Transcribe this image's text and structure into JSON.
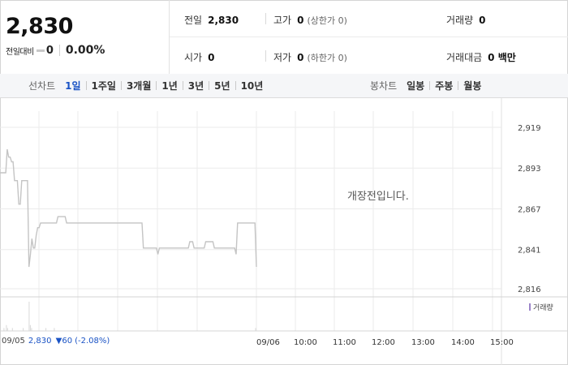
{
  "quote": {
    "price": "2,830",
    "change_label": "전일대비",
    "change_value": "0",
    "change_rate": "0.00%"
  },
  "stats": {
    "prev_close_label": "전일",
    "prev_close": "2,830",
    "high_label": "고가",
    "high": "0",
    "upper_limit": "(상한가 0)",
    "volume_label": "거래량",
    "volume": "0",
    "open_label": "시가",
    "open": "0",
    "low_label": "저가",
    "low": "0",
    "lower_limit": "(하한가 0)",
    "amount_label": "거래대금",
    "amount": "0 백만"
  },
  "tabs": {
    "line_title": "선차트",
    "line_items": [
      "1일",
      "1주일",
      "3개월",
      "1년",
      "3년",
      "5년",
      "10년"
    ],
    "active_index": 0,
    "candle_title": "봉차트",
    "candle_items": [
      "일봉",
      "주봉",
      "월봉"
    ]
  },
  "chart_data": {
    "type": "line",
    "y_ticks": [
      "2,919",
      "2,893",
      "2,867",
      "2,841",
      "2,816"
    ],
    "ylim": [
      2816,
      2919
    ],
    "x_labels": [
      "09/05",
      "09/06",
      "10:00",
      "11:00",
      "12:00",
      "13:00",
      "14:00",
      "15:00"
    ],
    "notice": "개장전입니다.",
    "volume_legend": "거래량",
    "prev_day_price": [
      2890,
      2890,
      2890,
      2890,
      2890,
      2905,
      2900,
      2900,
      2897,
      2897,
      2885,
      2885,
      2885,
      2870,
      2870,
      2885,
      2885,
      2885,
      2885,
      2885,
      2830,
      2838,
      2848,
      2842,
      2842,
      2850,
      2855,
      2855,
      2858,
      2858,
      2858,
      2858,
      2858,
      2858,
      2858,
      2858,
      2858,
      2858,
      2858,
      2858,
      2862,
      2862,
      2862,
      2862,
      2862,
      2862,
      2858,
      2858,
      2858,
      2858,
      2858,
      2858,
      2858,
      2858,
      2858,
      2858,
      2858,
      2858,
      2858,
      2858,
      2858,
      2858,
      2858,
      2858,
      2858,
      2858,
      2858,
      2858,
      2858,
      2858,
      2858,
      2858,
      2858,
      2858,
      2858,
      2858,
      2858,
      2858,
      2858,
      2858,
      2858,
      2858,
      2858,
      2858,
      2858,
      2858,
      2858,
      2858,
      2858,
      2858,
      2858,
      2858,
      2858,
      2858,
      2858,
      2858,
      2858,
      2858,
      2858,
      2842,
      2842,
      2842,
      2842,
      2842,
      2842,
      2842,
      2842,
      2842,
      2842,
      2838,
      2842,
      2842,
      2842,
      2842,
      2842,
      2842,
      2842,
      2842,
      2842,
      2842,
      2842,
      2842,
      2842,
      2842,
      2842,
      2842,
      2842,
      2842,
      2842,
      2842,
      2842,
      2846,
      2846,
      2846,
      2842,
      2842,
      2842,
      2842,
      2842,
      2842,
      2842,
      2842,
      2846,
      2846,
      2846,
      2846,
      2846,
      2846,
      2842,
      2842,
      2842,
      2842,
      2842,
      2842,
      2842,
      2842,
      2842,
      2842,
      2842,
      2842,
      2842,
      2842,
      2842,
      2838,
      2858,
      2858,
      2858,
      2858,
      2858,
      2858,
      2858,
      2858,
      2858,
      2858,
      2858,
      2858,
      2858,
      2830
    ],
    "prev_day_volume": [
      0,
      0,
      0,
      1,
      0,
      2,
      1,
      0,
      0,
      0,
      1,
      0,
      0,
      0,
      0,
      0,
      0,
      0,
      0,
      1,
      0,
      0,
      0,
      0,
      10,
      2,
      1,
      0,
      0,
      0,
      0,
      0,
      0,
      0,
      0,
      0,
      0,
      0,
      1,
      0,
      0,
      0,
      0,
      0,
      0,
      1,
      0,
      0,
      0,
      0,
      0,
      0,
      0,
      0,
      0,
      0,
      0,
      0,
      0,
      0,
      0,
      0,
      0,
      0,
      0,
      0,
      0,
      0,
      0,
      0,
      0,
      0,
      0,
      0,
      0,
      0,
      0,
      0,
      0,
      0,
      0,
      0,
      0,
      0,
      0,
      0,
      0,
      0,
      0,
      0,
      0,
      0,
      0,
      0,
      0,
      0,
      0,
      0,
      0,
      0,
      0,
      0,
      0,
      0,
      0,
      0,
      0,
      0,
      0,
      0,
      0,
      0,
      0,
      0,
      0,
      0,
      0,
      0,
      0,
      0,
      0,
      0,
      0,
      0,
      0,
      0,
      0,
      0,
      0,
      0,
      0,
      0,
      0,
      0,
      0,
      0,
      0,
      0,
      0,
      0,
      0,
      0,
      0,
      0,
      0,
      0,
      0,
      0,
      0,
      0,
      0,
      0,
      0,
      0,
      0,
      0,
      0,
      0,
      0,
      0,
      0,
      0,
      0,
      0,
      0,
      0,
      0,
      0,
      0,
      0,
      0,
      0,
      0,
      0,
      0,
      0,
      0,
      0,
      0,
      0,
      0,
      0,
      0,
      0,
      0,
      0,
      0,
      0,
      0,
      0,
      0,
      0,
      0,
      0,
      0,
      0,
      0,
      0,
      0,
      0,
      0,
      0,
      0,
      0,
      0,
      0,
      0,
      0,
      0,
      0,
      0,
      0,
      0,
      1
    ]
  },
  "hover": {
    "date": "09/05",
    "price": "2,830",
    "change": "▼60",
    "rate": "(-2.08%)"
  },
  "colors": {
    "accent": "#1a53c5",
    "line": "#c4c4c4",
    "grid": "#ebebeb"
  }
}
